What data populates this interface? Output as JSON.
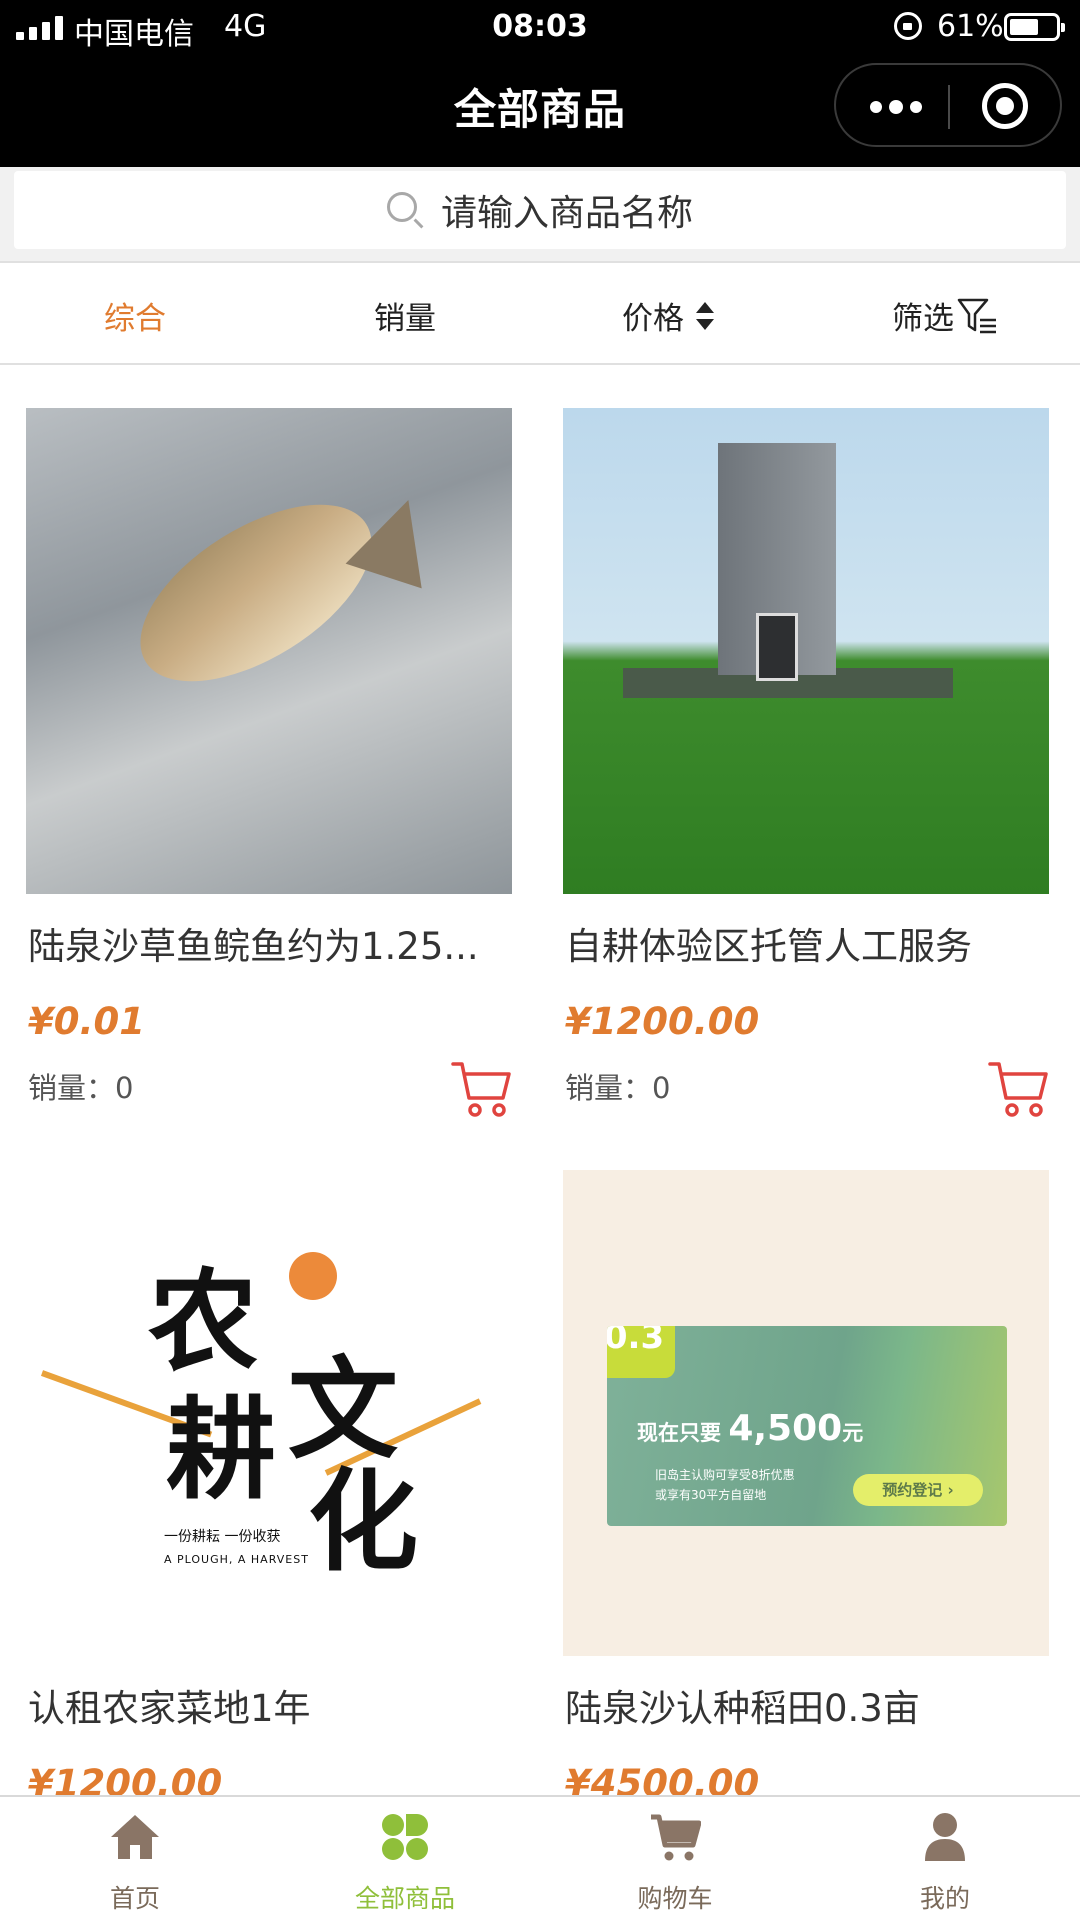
{
  "status_bar": {
    "carrier": "中国电信",
    "network": "4G",
    "time": "08:03",
    "battery": "61%"
  },
  "nav": {
    "title": "全部商品"
  },
  "search": {
    "placeholder": "请输入商品名称"
  },
  "filters": [
    {
      "label": "综合",
      "active": true
    },
    {
      "label": "销量",
      "active": false
    },
    {
      "label": "价格",
      "active": false
    },
    {
      "label": "筛选",
      "active": false
    }
  ],
  "products": [
    {
      "name": "陆泉沙草鱼鲩鱼约为1.25...",
      "price": "¥0.01",
      "sales": "销量：0"
    },
    {
      "name": "自耕体验区托管人工服务",
      "price": "¥1200.00",
      "sales": "销量：0"
    },
    {
      "name": "认租农家菜地1年",
      "price": "¥1200.00",
      "sales": ""
    },
    {
      "name": "陆泉沙认种稻田0.3亩",
      "price": "¥4500.00",
      "sales": ""
    }
  ],
  "farm_image": {
    "chars": [
      "农",
      "耕",
      "文",
      "化"
    ],
    "sub": "一份耕耘 一份收获",
    "sub_en": "A PLOUGH, A HARVEST"
  },
  "rice_image": {
    "tag": "0.3",
    "headline": "现在只要",
    "amount": "4,500",
    "unit": "元",
    "line1": "旧岛主认购可享受8折优惠",
    "line2": "或享有30平方自留地",
    "cta": "预约登记 ›"
  },
  "tabbar": [
    {
      "label": "首页",
      "icon": "home-icon",
      "active": false
    },
    {
      "label": "全部商品",
      "icon": "clover-icon",
      "active": true
    },
    {
      "label": "购物车",
      "icon": "cart-icon",
      "active": false
    },
    {
      "label": "我的",
      "icon": "user-icon",
      "active": false
    }
  ],
  "colors": {
    "accent": "#e07b2f",
    "tab_active": "#8fbf3a",
    "tab_inactive": "#8a7566",
    "cart_icon": "#e0443f"
  }
}
